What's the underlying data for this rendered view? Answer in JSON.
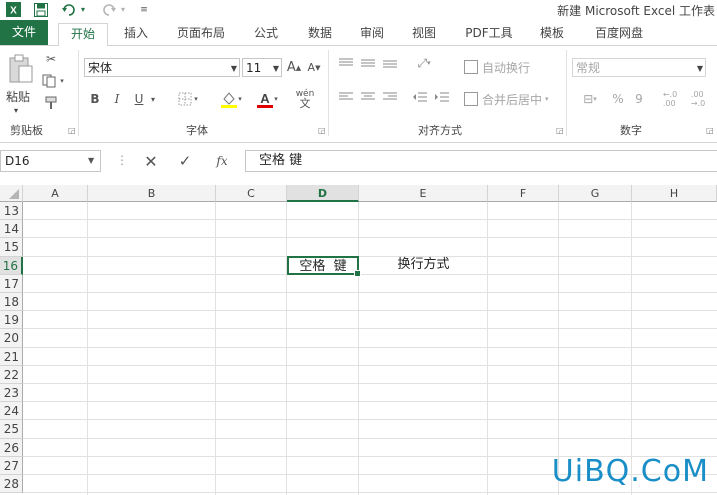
{
  "window": {
    "title": "新建 Microsoft Excel 工作表"
  },
  "quick_access": {
    "excel_icon": "excel-logo-icon",
    "save_icon": "save-icon",
    "undo_icon": "undo-icon",
    "redo_icon": "redo-icon",
    "customize_icon": "customize-icon"
  },
  "tabs": [
    "文件",
    "开始",
    "插入",
    "页面布局",
    "公式",
    "数据",
    "审阅",
    "视图",
    "PDF工具",
    "模板",
    "百度网盘"
  ],
  "active_tab": "开始",
  "ribbon": {
    "clipboard": {
      "paste": "粘贴",
      "label": "剪贴板"
    },
    "font": {
      "name": "宋体",
      "size": "11",
      "bold": "B",
      "italic": "I",
      "underline": "U",
      "grow": "A",
      "shrink": "A",
      "wen": "wén\n文",
      "label": "字体"
    },
    "alignment": {
      "wrap": "自动换行",
      "merge": "合并后居中",
      "label": "对齐方式"
    },
    "number": {
      "format": "常规",
      "percent": "%",
      "comma": "9",
      "label": "数字"
    }
  },
  "formula_bar": {
    "name_box": "D16",
    "content": "空格 键",
    "fx": "fx"
  },
  "grid": {
    "columns": [
      "A",
      "B",
      "C",
      "D",
      "E",
      "F",
      "G",
      "H"
    ],
    "rows": [
      "13",
      "14",
      "15",
      "16",
      "17",
      "18",
      "19",
      "20",
      "21",
      "22",
      "23",
      "24",
      "25",
      "26",
      "27",
      "28"
    ],
    "active_cell": "D16",
    "cells": {
      "D16": "空格  键",
      "E16": "换行方式"
    }
  },
  "watermark": "UiBQ.CoM",
  "colors": {
    "accent": "#217346",
    "active_header_text": "#217346"
  }
}
